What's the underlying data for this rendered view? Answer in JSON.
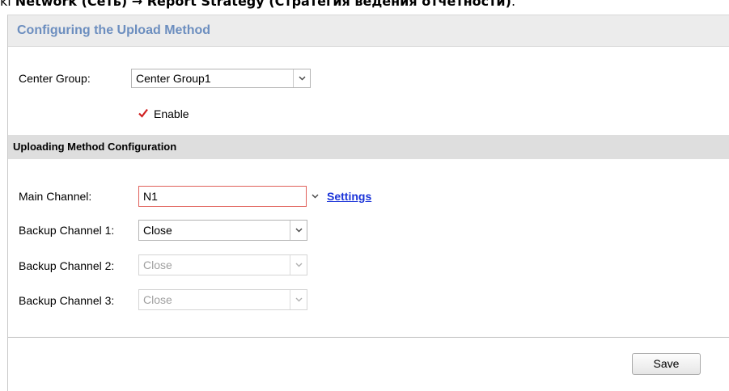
{
  "doc_line": {
    "prefix": "ki ",
    "bold_path": "Network (Сеть) → Report Strategy (Стратегия ведения отчетности)",
    "suffix": "."
  },
  "panel": {
    "title": "Configuring the Upload Method"
  },
  "center_group": {
    "label": "Center Group:",
    "value": "Center Group1"
  },
  "enable": {
    "label": "Enable",
    "checked": true
  },
  "section": {
    "title": "Uploading Method Configuration"
  },
  "channels": {
    "main": {
      "label": "Main Channel:",
      "value": "N1",
      "settings_link": "Settings"
    },
    "backup1": {
      "label": "Backup Channel 1:",
      "value": "Close",
      "enabled": true
    },
    "backup2": {
      "label": "Backup Channel 2:",
      "value": "Close",
      "enabled": false
    },
    "backup3": {
      "label": "Backup Channel 3:",
      "value": "Close",
      "enabled": false
    }
  },
  "actions": {
    "save_label": "Save"
  },
  "colors": {
    "title": "#6c8ebf",
    "link": "#1a33d8",
    "check": "#d02020",
    "error_border": "#e0605a"
  }
}
